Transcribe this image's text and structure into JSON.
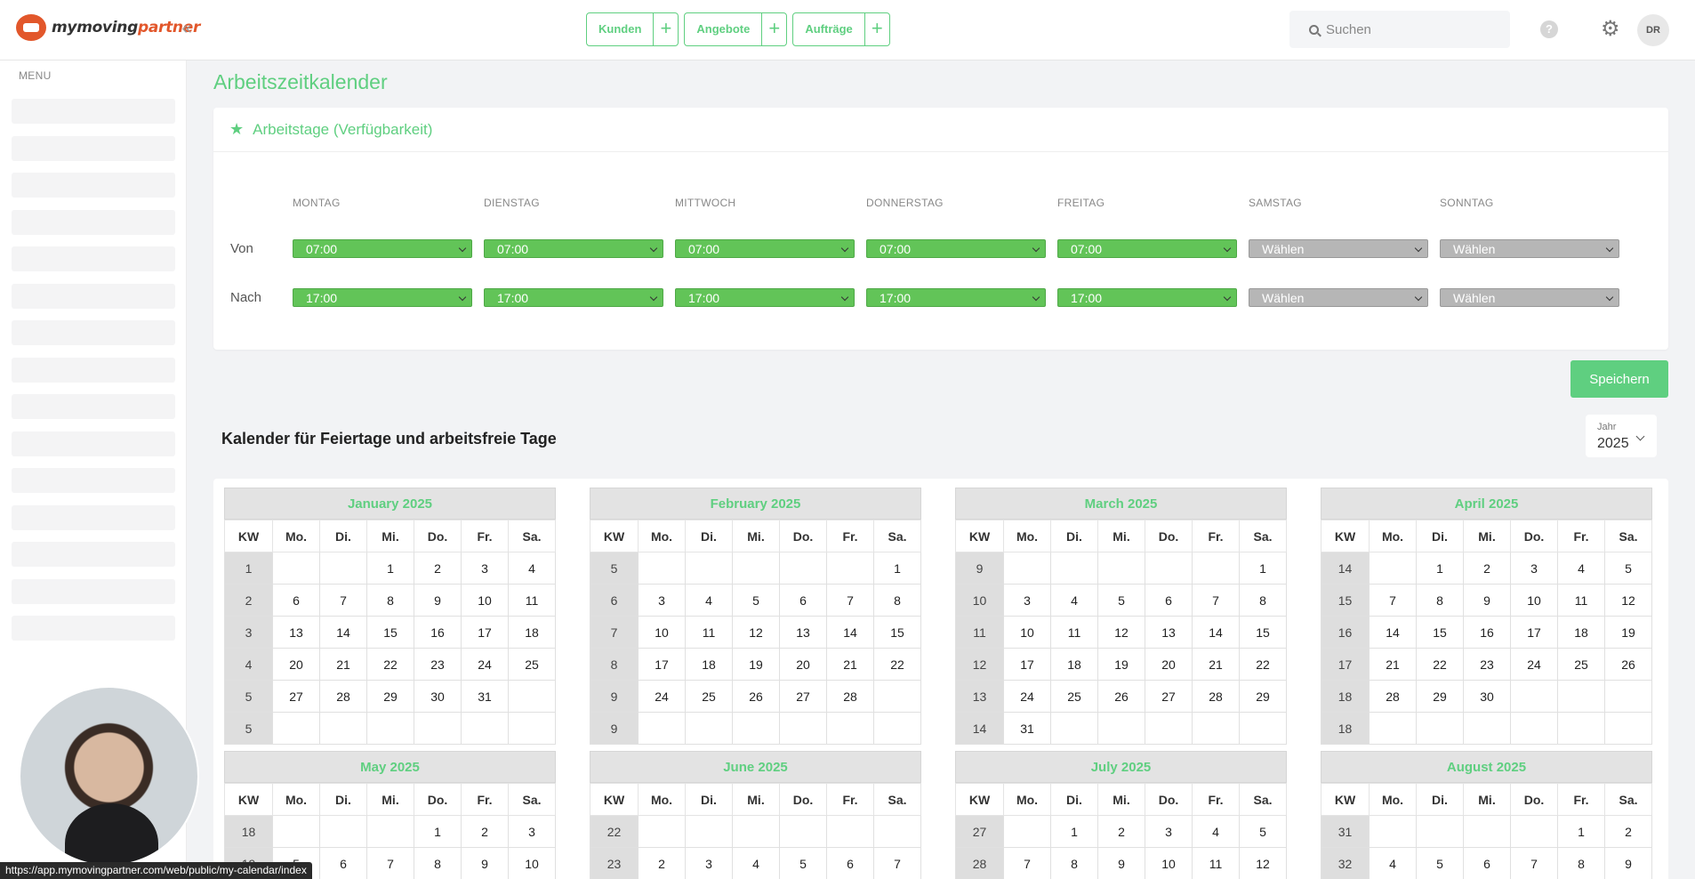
{
  "app": {
    "logo_text_main": "mymoving",
    "logo_text_accent": "partner",
    "collapse_glyph": "«",
    "search_placeholder": "Suchen",
    "help_glyph": "?",
    "gear_glyph": "⚙",
    "avatar_initials": "DR"
  },
  "quick_actions": [
    {
      "label": "Kunden",
      "plus": "+"
    },
    {
      "label": "Angebote",
      "plus": "+"
    },
    {
      "label": "Aufträge",
      "plus": "+"
    }
  ],
  "sidebar": {
    "menu_title": "MENU",
    "placeholder_count": 15
  },
  "page": {
    "title": "Arbeitszeitkalender"
  },
  "availability": {
    "title": "Arbeitstage (Verfügbarkeit)",
    "star_glyph": "★",
    "row_from": "Von",
    "row_to": "Nach",
    "days": [
      {
        "name": "MONTAG",
        "from": "07:00",
        "to": "17:00",
        "active": true
      },
      {
        "name": "DIENSTAG",
        "from": "07:00",
        "to": "17:00",
        "active": true
      },
      {
        "name": "MITTWOCH",
        "from": "07:00",
        "to": "17:00",
        "active": true
      },
      {
        "name": "DONNERSTAG",
        "from": "07:00",
        "to": "17:00",
        "active": true
      },
      {
        "name": "FREITAG",
        "from": "07:00",
        "to": "17:00",
        "active": true
      },
      {
        "name": "SAMSTAG",
        "from": "Wählen",
        "to": "Wählen",
        "active": false
      },
      {
        "name": "SONNTAG",
        "from": "Wählen",
        "to": "Wählen",
        "active": false
      }
    ],
    "save_label": "Speichern"
  },
  "holidays": {
    "title": "Kalender für Feiertage und arbeitsfreie Tage",
    "year_label": "Jahr",
    "year_value": "2025",
    "weekday_headers": [
      "KW",
      "Mo.",
      "Di.",
      "Mi.",
      "Do.",
      "Fr.",
      "Sa."
    ],
    "months": [
      {
        "title": "January 2025",
        "rows": [
          [
            "1",
            "",
            "",
            "1",
            "2",
            "3",
            "4"
          ],
          [
            "2",
            "6",
            "7",
            "8",
            "9",
            "10",
            "11"
          ],
          [
            "3",
            "13",
            "14",
            "15",
            "16",
            "17",
            "18"
          ],
          [
            "4",
            "20",
            "21",
            "22",
            "23",
            "24",
            "25"
          ],
          [
            "5",
            "27",
            "28",
            "29",
            "30",
            "31",
            ""
          ],
          [
            "5",
            "",
            "",
            "",
            "",
            "",
            ""
          ]
        ]
      },
      {
        "title": "February 2025",
        "rows": [
          [
            "5",
            "",
            "",
            "",
            "",
            "",
            "1"
          ],
          [
            "6",
            "3",
            "4",
            "5",
            "6",
            "7",
            "8"
          ],
          [
            "7",
            "10",
            "11",
            "12",
            "13",
            "14",
            "15"
          ],
          [
            "8",
            "17",
            "18",
            "19",
            "20",
            "21",
            "22"
          ],
          [
            "9",
            "24",
            "25",
            "26",
            "27",
            "28",
            ""
          ],
          [
            "9",
            "",
            "",
            "",
            "",
            "",
            ""
          ]
        ]
      },
      {
        "title": "March 2025",
        "rows": [
          [
            "9",
            "",
            "",
            "",
            "",
            "",
            "1"
          ],
          [
            "10",
            "3",
            "4",
            "5",
            "6",
            "7",
            "8"
          ],
          [
            "11",
            "10",
            "11",
            "12",
            "13",
            "14",
            "15"
          ],
          [
            "12",
            "17",
            "18",
            "19",
            "20",
            "21",
            "22"
          ],
          [
            "13",
            "24",
            "25",
            "26",
            "27",
            "28",
            "29"
          ],
          [
            "14",
            "31",
            "",
            "",
            "",
            "",
            ""
          ]
        ]
      },
      {
        "title": "April 2025",
        "rows": [
          [
            "14",
            "",
            "1",
            "2",
            "3",
            "4",
            "5"
          ],
          [
            "15",
            "7",
            "8",
            "9",
            "10",
            "11",
            "12"
          ],
          [
            "16",
            "14",
            "15",
            "16",
            "17",
            "18",
            "19"
          ],
          [
            "17",
            "21",
            "22",
            "23",
            "24",
            "25",
            "26"
          ],
          [
            "18",
            "28",
            "29",
            "30",
            "",
            "",
            ""
          ],
          [
            "18",
            "",
            "",
            "",
            "",
            "",
            ""
          ]
        ]
      },
      {
        "title": "May 2025",
        "rows": [
          [
            "18",
            "",
            "",
            "",
            "1",
            "2",
            "3"
          ],
          [
            "19",
            "5",
            "6",
            "7",
            "8",
            "9",
            "10"
          ]
        ]
      },
      {
        "title": "June 2025",
        "rows": [
          [
            "22",
            "",
            "",
            "",
            "",
            "",
            ""
          ],
          [
            "23",
            "2",
            "3",
            "4",
            "5",
            "6",
            "7"
          ]
        ]
      },
      {
        "title": "July 2025",
        "rows": [
          [
            "27",
            "",
            "1",
            "2",
            "3",
            "4",
            "5"
          ],
          [
            "28",
            "7",
            "8",
            "9",
            "10",
            "11",
            "12"
          ]
        ]
      },
      {
        "title": "August 2025",
        "rows": [
          [
            "31",
            "",
            "",
            "",
            "",
            "1",
            "2"
          ],
          [
            "32",
            "4",
            "5",
            "6",
            "7",
            "8",
            "9"
          ]
        ]
      }
    ]
  },
  "status_bar": {
    "url": "https://app.mymovingpartner.com/web/public/my-calendar/index"
  },
  "colors": {
    "accent": "#5fcf80",
    "select_green": "#62c458",
    "select_grey": "#b6b6b6",
    "logo_orange": "#e2572b"
  }
}
